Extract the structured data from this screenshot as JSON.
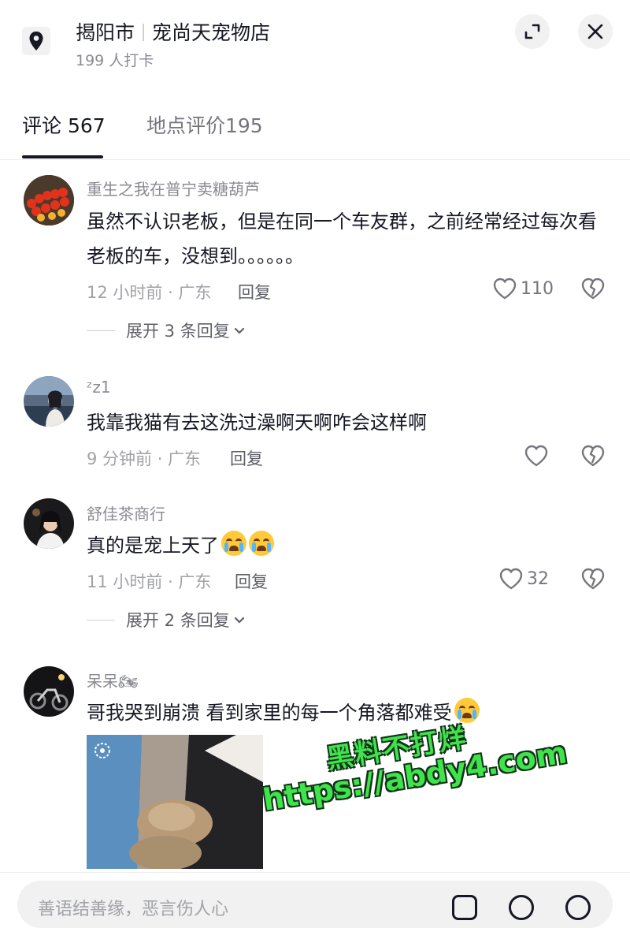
{
  "header": {
    "city": "揭阳市",
    "store": "宠尚天宠物店",
    "checkins": "199 人打卡",
    "icons": {
      "location": "location-pin-icon",
      "expand": "expand-icon",
      "close": "close-icon"
    }
  },
  "tabs": [
    {
      "label": "评论 567",
      "active": true
    },
    {
      "label": "地点评价195",
      "active": false
    }
  ],
  "comments": [
    {
      "username": "重生之我在普宁卖糖葫芦",
      "text": "虽然不认识老板，但是在同一个车友群，之前经常经过每次看老板的车，没想到。。。。。。",
      "time": "12 小时前 · 广东",
      "reply_label": "回复",
      "likes": "110",
      "expand": "展开 3 条回复"
    },
    {
      "username": "ᶻz1",
      "text": "我靠我猫有去这洗过澡啊天啊咋会这样啊",
      "time": "9 分钟前 · 广东",
      "reply_label": "回复",
      "likes": ""
    },
    {
      "username": "舒佳茶商行",
      "text": "真的是宠上天了",
      "time": "11 小时前 · 广东",
      "reply_label": "回复",
      "likes": "32",
      "expand": "展开 2 条回复"
    },
    {
      "username": "呆呆🏍",
      "text": "哥我哭到崩溃 看到家里的每一个角落都难受",
      "time": "",
      "reply_label": "",
      "likes": ""
    }
  ],
  "watermark": {
    "line1": "黑料不打烊",
    "line2": "https://abdy4.com"
  },
  "input": {
    "placeholder": "善语结善缘，恶言伤人心"
  },
  "colors": {
    "text": "#161823",
    "secondary": "#8a8b91",
    "watermark": "#3fe34a"
  }
}
